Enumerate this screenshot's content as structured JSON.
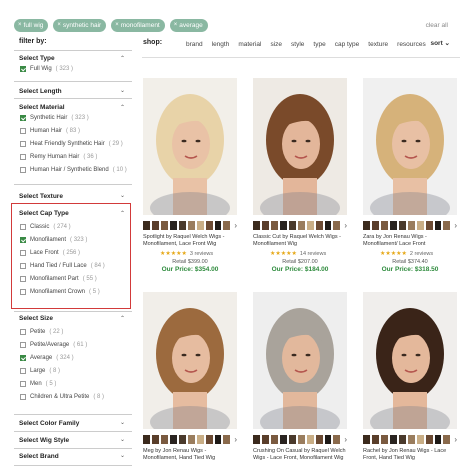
{
  "chips": [
    {
      "label": "full wig"
    },
    {
      "label": "synthetic hair"
    },
    {
      "label": "monofilament"
    },
    {
      "label": "average"
    }
  ],
  "chip_close": "×",
  "clear_all": "clear all",
  "filter_by": "filter by:",
  "shop_label": "shop:",
  "sort_links": [
    "brand",
    "length",
    "material",
    "size",
    "style",
    "type",
    "cap type",
    "texture",
    "resources"
  ],
  "sort_label": "sort",
  "sort_caret": "⌄",
  "sidebar": {
    "select_type": {
      "title": "Select Type",
      "caret": "⌃",
      "options": [
        {
          "label": "Full Wig",
          "count": "( 323 )",
          "checked": true
        }
      ]
    },
    "select_length": {
      "title": "Select Length",
      "caret": "⌄"
    },
    "select_material": {
      "title": "Select Material",
      "caret": "⌃",
      "options": [
        {
          "label": "Synthetic Hair",
          "count": "( 323 )",
          "checked": true
        },
        {
          "label": "Human Hair",
          "count": "( 83 )",
          "checked": false
        },
        {
          "label": "Heat Friendly Synthetic Hair",
          "count": "( 29 )",
          "checked": false
        },
        {
          "label": "Remy Human Hair",
          "count": "( 36 )",
          "checked": false
        },
        {
          "label": "Human Hair / Synthetic Blend",
          "count": "( 10 )",
          "checked": false
        }
      ]
    },
    "select_texture": {
      "title": "Select Texture",
      "caret": "⌄"
    },
    "select_cap_type": {
      "title": "Select Cap Type",
      "caret": "⌃",
      "options": [
        {
          "label": "Classic",
          "count": "( 274 )",
          "checked": false
        },
        {
          "label": "Monofilament",
          "count": "( 323 )",
          "checked": true
        },
        {
          "label": "Lace Front",
          "count": "( 256 )",
          "checked": false
        },
        {
          "label": "Hand Tied / Full Lace",
          "count": "( 84 )",
          "checked": false
        },
        {
          "label": "Monofilament Part",
          "count": "( 55 )",
          "checked": false
        },
        {
          "label": "Monofilament Crown",
          "count": "( 5 )",
          "checked": false
        }
      ]
    },
    "select_size": {
      "title": "Select Size",
      "caret": "⌃",
      "options": [
        {
          "label": "Petite",
          "count": "( 22 )",
          "checked": false
        },
        {
          "label": "Petite/Average",
          "count": "( 61 )",
          "checked": false
        },
        {
          "label": "Average",
          "count": "( 324 )",
          "checked": true
        },
        {
          "label": "Large",
          "count": "( 8 )",
          "checked": false
        },
        {
          "label": "Men",
          "count": "( 5 )",
          "checked": false
        },
        {
          "label": "Children & Ultra Petite",
          "count": "( 8 )",
          "checked": false
        }
      ]
    },
    "select_color_family": {
      "title": "Select Color Family",
      "caret": "⌄"
    },
    "select_wig_style": {
      "title": "Select Wig Style",
      "caret": "⌄"
    },
    "select_brand": {
      "title": "Select Brand",
      "caret": "⌄"
    }
  },
  "products": [
    {
      "name": "Spotlight by Raquel Welch Wigs - Monofilament, Lace Front Wig",
      "stars": "★★★★★",
      "reviews": "3 reviews",
      "retail": "Retail $399.00",
      "price": "Our Price: $354.00",
      "hair": "#e8d3a8",
      "skin": "#e9c2a6",
      "bg": "#f2efe9",
      "swatches": [
        "#3b2a1d",
        "#5a3e2b",
        "#7a5a40",
        "#2a2420",
        "#4a3a2c",
        "#9a7d5e",
        "#c9ae86",
        "#6b4a33",
        "#1e1a17",
        "#8a6a4c"
      ]
    },
    {
      "name": "Classic Cut by Raquel Welch Wigs - Monofilament Wig",
      "stars": "★★★★★",
      "reviews": "14 reviews",
      "retail": "Retail $207.00",
      "price": "Our Price: $184.00",
      "hair": "#7a4a2a",
      "skin": "#e3b69a",
      "bg": "#eeeae4",
      "swatches": [
        "#3b2a1d",
        "#5a3e2b",
        "#7a5a40",
        "#2a2420",
        "#4a3a2c",
        "#9a7d5e",
        "#c9ae86",
        "#6b4a33",
        "#1e1a17",
        "#8a6a4c"
      ]
    },
    {
      "name": "Zara by Jon Renau Wigs - Monofilament/ Lace Front",
      "stars": "★★★★★",
      "reviews": "2 reviews",
      "retail": "Retail $374.40",
      "price": "Our Price: $318.50",
      "hair": "#d6b27a",
      "skin": "#e8c0a4",
      "bg": "#f0f0f0",
      "swatches": [
        "#3b2a1d",
        "#5a3e2b",
        "#7a5a40",
        "#2a2420",
        "#4a3a2c",
        "#9a7d5e",
        "#c9ae86",
        "#6b4a33",
        "#1e1a17",
        "#8a6a4c"
      ]
    },
    {
      "name": "Meg by Jon Renau Wigs - Monofilament, Hand Tied Wig",
      "hair": "#9c6a3e",
      "skin": "#e6bca0",
      "bg": "#f1eee9",
      "swatches": [
        "#3b2a1d",
        "#5a3e2b",
        "#7a5a40",
        "#2a2420",
        "#4a3a2c",
        "#9a7d5e",
        "#c9ae86",
        "#6b4a33",
        "#1e1a17",
        "#8a6a4c"
      ]
    },
    {
      "name": "Crushing On Casual by Raquel Welch Wigs - Lace Front, Monofilament Wig",
      "hair": "#a9a39b",
      "skin": "#e2b89c",
      "bg": "#eeeeee",
      "swatches": [
        "#3b2a1d",
        "#5a3e2b",
        "#7a5a40",
        "#2a2420",
        "#4a3a2c",
        "#9a7d5e",
        "#c9ae86",
        "#6b4a33",
        "#1e1a17",
        "#8a6a4c"
      ]
    },
    {
      "name": "Rachel by Jon Renau Wigs - Lace Front, Hand Tied Wig",
      "hair": "#3a2418",
      "skin": "#e4b89b",
      "bg": "#f0eeec",
      "swatches": [
        "#3b2a1d",
        "#5a3e2b",
        "#7a5a40",
        "#2a2420",
        "#4a3a2c",
        "#9a7d5e",
        "#c9ae86",
        "#6b4a33",
        "#1e1a17",
        "#8a6a4c"
      ]
    }
  ],
  "swatch_arrow": "›",
  "colors": {
    "chip": "#8ab8a2",
    "check": "#3a8a45",
    "price": "#2e8b3d",
    "star": "#e6a817",
    "highlight": "#d23a3a"
  }
}
